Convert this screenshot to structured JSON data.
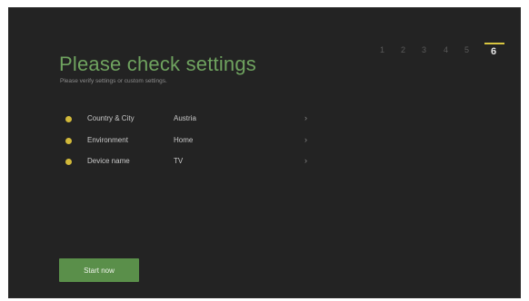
{
  "screen": {
    "title": "Please check settings",
    "subtitle": "Please verify settings or custom settings.",
    "colors": {
      "background": "#232323",
      "title": "#6fa35f",
      "status_dot": "#d2b93a",
      "step_marker": "#d9c640",
      "button": "#5a8f4a"
    }
  },
  "stepper": {
    "steps": [
      "1",
      "2",
      "3",
      "4",
      "5",
      "6"
    ],
    "current": "6"
  },
  "settings": [
    {
      "label": "Country & City",
      "value": "Austria",
      "icon": "status-dot-icon",
      "chevron": "›"
    },
    {
      "label": "Environment",
      "value": "Home",
      "icon": "status-dot-icon",
      "chevron": "›"
    },
    {
      "label": "Device name",
      "value": "TV",
      "icon": "status-dot-icon",
      "chevron": "›"
    }
  ],
  "actions": {
    "start_label": "Start now"
  }
}
